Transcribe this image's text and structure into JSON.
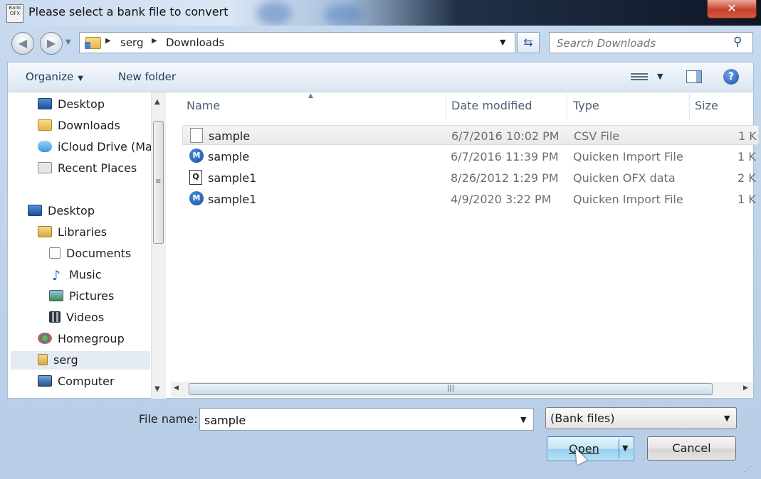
{
  "window": {
    "title": "Please select a bank file to convert",
    "close_label": "✕"
  },
  "nav": {
    "breadcrumb": [
      "serg",
      "Downloads"
    ],
    "search_placeholder": "Search Downloads"
  },
  "toolbar": {
    "organize_label": "Organize",
    "new_folder_label": "New folder"
  },
  "sidebar": {
    "items": [
      {
        "label": "Desktop",
        "icon": "desktop-icon"
      },
      {
        "label": "Downloads",
        "icon": "downloads-folder-icon"
      },
      {
        "label": "iCloud Drive (Ma",
        "icon": "icloud-icon"
      },
      {
        "label": "Recent Places",
        "icon": "recent-places-icon"
      },
      {
        "label": "Desktop",
        "icon": "desktop-icon"
      },
      {
        "label": "Libraries",
        "icon": "libraries-icon"
      },
      {
        "label": "Documents",
        "icon": "documents-icon"
      },
      {
        "label": "Music",
        "icon": "music-icon"
      },
      {
        "label": "Pictures",
        "icon": "pictures-icon"
      },
      {
        "label": "Videos",
        "icon": "videos-icon"
      },
      {
        "label": "Homegroup",
        "icon": "homegroup-icon"
      },
      {
        "label": "serg",
        "icon": "user-folder-icon"
      },
      {
        "label": "Computer",
        "icon": "computer-icon"
      }
    ]
  },
  "files": {
    "columns": [
      "Name",
      "Date modified",
      "Type",
      "Size"
    ],
    "rows": [
      {
        "name": "sample",
        "date": "6/7/2016 10:02 PM",
        "type": "CSV File",
        "size": "1 K",
        "icon": "csv-file-icon"
      },
      {
        "name": "sample",
        "date": "6/7/2016 11:39 PM",
        "type": "Quicken Import File",
        "size": "1 K",
        "icon": "quicken-file-icon"
      },
      {
        "name": "sample1",
        "date": "8/26/2012 1:29 PM",
        "type": "Quicken OFX data",
        "size": "2 K",
        "icon": "ofx-file-icon"
      },
      {
        "name": "sample1",
        "date": "4/9/2020 3:22 PM",
        "type": "Quicken Import File",
        "size": "1 K",
        "icon": "quicken-file-icon"
      }
    ]
  },
  "bottom": {
    "filename_label": "File name:",
    "filename_value": "sample",
    "filter_value": "(Bank files)",
    "open_label": "Open",
    "cancel_label": "Cancel"
  }
}
